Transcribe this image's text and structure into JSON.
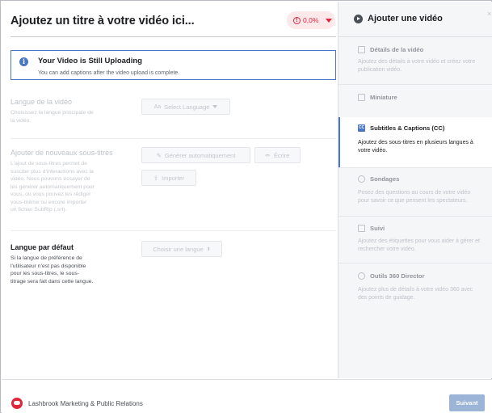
{
  "header": {
    "title": "Ajoutez un titre à votre vidéo ici...",
    "progress": "0,0%"
  },
  "banner": {
    "heading": "Your Video is Still Uploading",
    "message": "You can add captions after the video upload is complete."
  },
  "language": {
    "title": "Langue de la vidéo",
    "desc_lines": [
      "Choisissez la langue principale de",
      "la vidéo."
    ],
    "select_label": "Select Language"
  },
  "subtitles": {
    "title": "Ajouter de nouveaux sous-titres",
    "desc_lines": [
      "L'ajout de sous-titres permet de",
      "susciter plus d'interactions avec la",
      "vidéo. Nous pouvons essayer de",
      "les générer automatiquement pour",
      "vous, ou vous pouvez les rédiger",
      "vous-même ou encore importer",
      "un fichier SubRip (.srt)."
    ],
    "auto_label": "Générer automatiquement",
    "write_label": "Écrire",
    "import_label": "Importer"
  },
  "default_language": {
    "title": "Langue par défaut",
    "desc_lines": [
      "Si la langue de préférence de",
      "l'utilisateur n'est pas disponible",
      "pour les sous-titres, le sous-",
      "titrage sera fait dans cette langue."
    ],
    "choose_label": "Choisir une langue"
  },
  "sidebar": {
    "title": "Ajouter une vidéo",
    "close": "×",
    "steps": [
      {
        "name": "Détails de la vidéo",
        "desc_lines": [
          "Ajoutez des détails à votre vidéo et créez votre",
          "publication vidéo."
        ]
      },
      {
        "name": "Miniature",
        "desc_lines": []
      },
      {
        "name": "Subtitles & Captions (CC)",
        "desc_lines": [
          "Ajoutez des sous-titres en plusieurs langues à",
          "votre vidéo."
        ]
      },
      {
        "name": "Sondages",
        "desc_lines": [
          "Posez des questions au cours de votre vidéo",
          "pour savoir ce que pensent les spectateurs."
        ]
      },
      {
        "name": "Suivi",
        "desc_lines": [
          "Ajoutez des étiquettes pour vous aider à gérer et",
          "rechercher votre vidéo."
        ]
      },
      {
        "name": "Outils 360 Director",
        "desc_lines": [
          "Ajoutez plus de détails à votre vidéo 360 avec",
          "des points de guidage."
        ]
      }
    ]
  },
  "footer": {
    "brand": "Lashbrook Marketing & Public Relations",
    "next_label": "Suivant"
  },
  "colors": {
    "accent": "#4a76c6",
    "danger": "#e0263a",
    "next_button": "#9cb4d8"
  }
}
